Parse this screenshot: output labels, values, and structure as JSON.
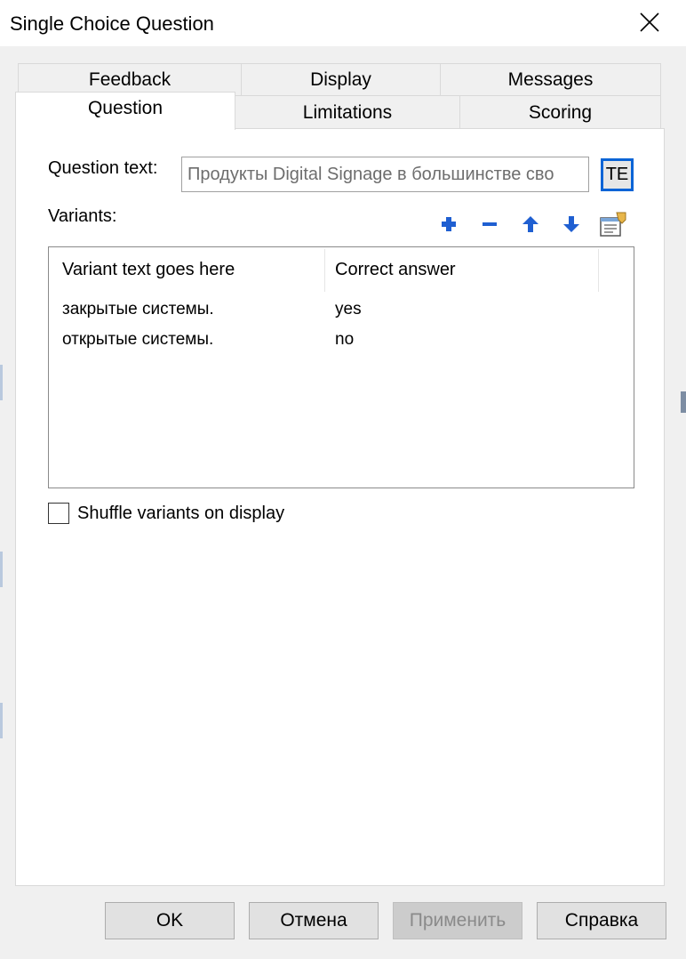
{
  "window": {
    "title": "Single Choice Question"
  },
  "tabs": {
    "back_row": [
      "Feedback",
      "Display",
      "Messages"
    ],
    "front_row": [
      "Question",
      "Limitations",
      "Scoring"
    ],
    "active": "Question"
  },
  "question": {
    "label": "Question text:",
    "value": "Продукты Digital Signage в большинстве сво",
    "te_button": "TE"
  },
  "variants": {
    "label": "Variants:",
    "toolbar": [
      "plus-icon",
      "minus-icon",
      "arrow-up-icon",
      "arrow-down-icon",
      "properties-icon"
    ],
    "columns": [
      "Variant text goes here",
      "Correct answer"
    ],
    "rows": [
      {
        "text": "закрытые системы.",
        "correct": "yes"
      },
      {
        "text": "открытые системы.",
        "correct": "no"
      }
    ]
  },
  "shuffle": {
    "label": "Shuffle variants on display",
    "checked": false
  },
  "buttons": {
    "ok": "OK",
    "cancel": "Отмена",
    "apply": "Применить",
    "help": "Справка"
  },
  "colors": {
    "focus_border": "#0a64d6",
    "toolbar_blue": "#1f5fd1"
  }
}
